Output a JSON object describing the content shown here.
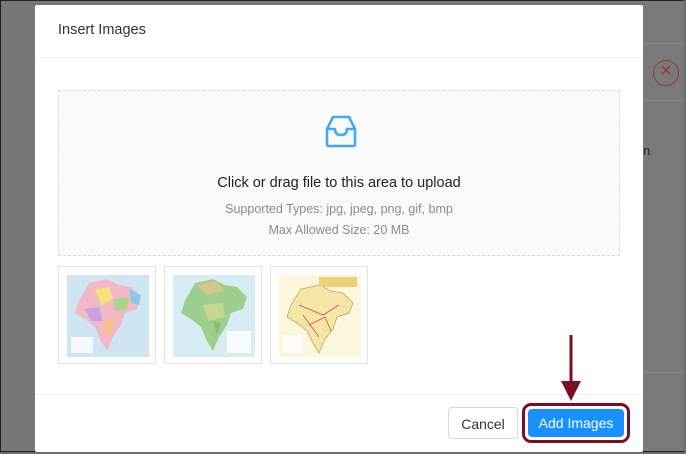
{
  "modal": {
    "title": "Insert Images"
  },
  "dropzone": {
    "icon": "inbox-icon",
    "main_text": "Click or drag file to this area to upload",
    "supported_types": "Supported Types: jpg, jpeg, png, gif, bmp",
    "max_size": "Max Allowed Size: 20 MB"
  },
  "thumbnails": [
    {
      "name": "india-map-political"
    },
    {
      "name": "india-map-physical"
    },
    {
      "name": "india-map-railway"
    }
  ],
  "footer": {
    "cancel_label": "Cancel",
    "add_label": "Add Images"
  },
  "background": {
    "close_icon": "close-circle-icon",
    "partial_letter": "n"
  },
  "colors": {
    "primary": "#1890ff",
    "highlight": "#7a1020",
    "icon": "#40a9ff"
  }
}
